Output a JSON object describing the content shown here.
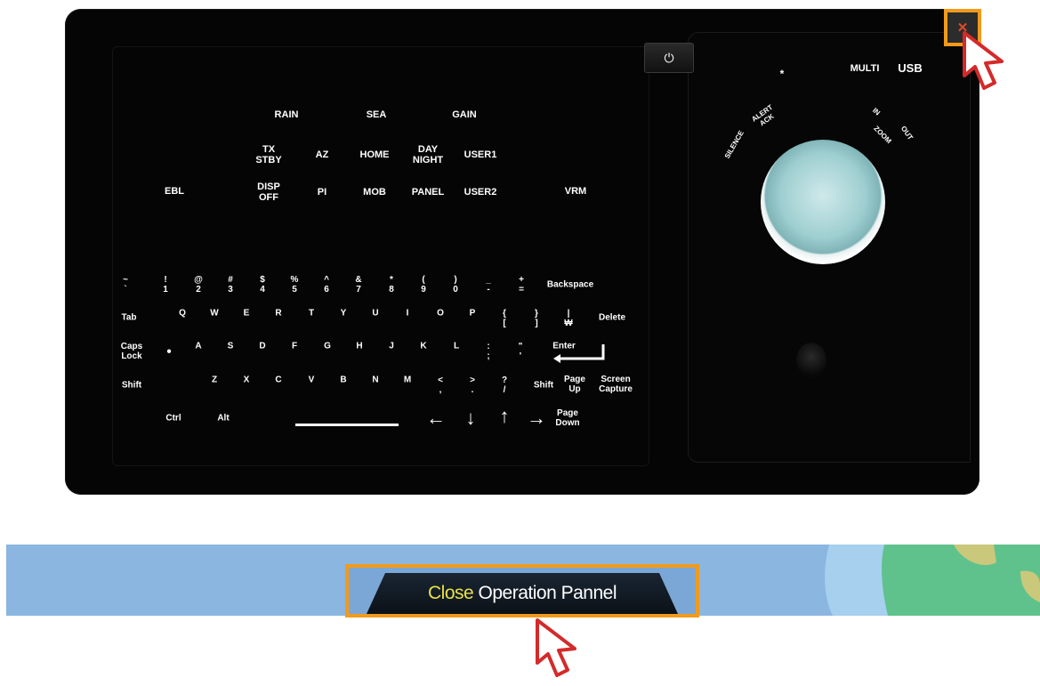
{
  "panel": {
    "top_row": [
      "RAIN",
      "SEA",
      "GAIN"
    ],
    "function_keys": [
      {
        "name": "tx-stby-key",
        "label": "TX\nSTBY"
      },
      {
        "name": "az-key",
        "label": "AZ"
      },
      {
        "name": "home-key",
        "label": "HOME"
      },
      {
        "name": "day-night-key",
        "label": "DAY\nNIGHT"
      },
      {
        "name": "user1-key",
        "label": "USER1"
      },
      {
        "name": "ebl-key",
        "label": "EBL"
      },
      {
        "name": "disp-off-key",
        "label": "DISP\nOFF"
      },
      {
        "name": "pi-key",
        "label": "PI"
      },
      {
        "name": "mob-key",
        "label": "MOB"
      },
      {
        "name": "panel-key",
        "label": "PANEL"
      },
      {
        "name": "user2-key",
        "label": "USER2"
      },
      {
        "name": "vrm-key",
        "label": "VRM"
      }
    ],
    "keyboard_rows": [
      [
        "~\n`",
        "!\n1",
        "@\n2",
        "#\n3",
        "$\n4",
        "%\n5",
        "^\n6",
        "&\n7",
        "*\n8",
        "(\n9",
        ")\n0",
        "_\n-",
        "+\n=",
        "Backspace"
      ],
      [
        "Tab",
        "Q",
        "W",
        "E",
        "R",
        "T",
        "Y",
        "U",
        "I",
        "O",
        "P",
        "{\n[",
        "}\n]",
        "|\n₩",
        "Delete"
      ],
      [
        "Caps\nLock",
        "●",
        "A",
        "S",
        "D",
        "F",
        "G",
        "H",
        "J",
        "K",
        "L",
        ":\n;",
        "\"\n'",
        "Enter"
      ],
      [
        "Shift",
        "Z",
        "X",
        "C",
        "V",
        "B",
        "N",
        "M",
        "<\n,",
        ">\n.",
        "?\n/",
        "Shift",
        "Page\nUp",
        "Screen\nCapture"
      ],
      [
        "Ctrl",
        "Alt",
        "←",
        "↓",
        "↑",
        "→",
        "Page\nDown"
      ]
    ],
    "right": {
      "power_icon": "power-icon",
      "asterisk": "*",
      "multi": "MULTI",
      "usb": "USB",
      "silence": "SILENCE",
      "alert_ack": "ALERT\nACK",
      "in": "IN",
      "zoom": "ZOOM",
      "out": "OUT"
    }
  },
  "close_button_icon": "close-icon",
  "bottom_bar": {
    "button_word1": "Close",
    "button_word2": "Operation Pannel",
    "word1_color": "#e8e04a",
    "highlight_color": "#f19a1c"
  }
}
